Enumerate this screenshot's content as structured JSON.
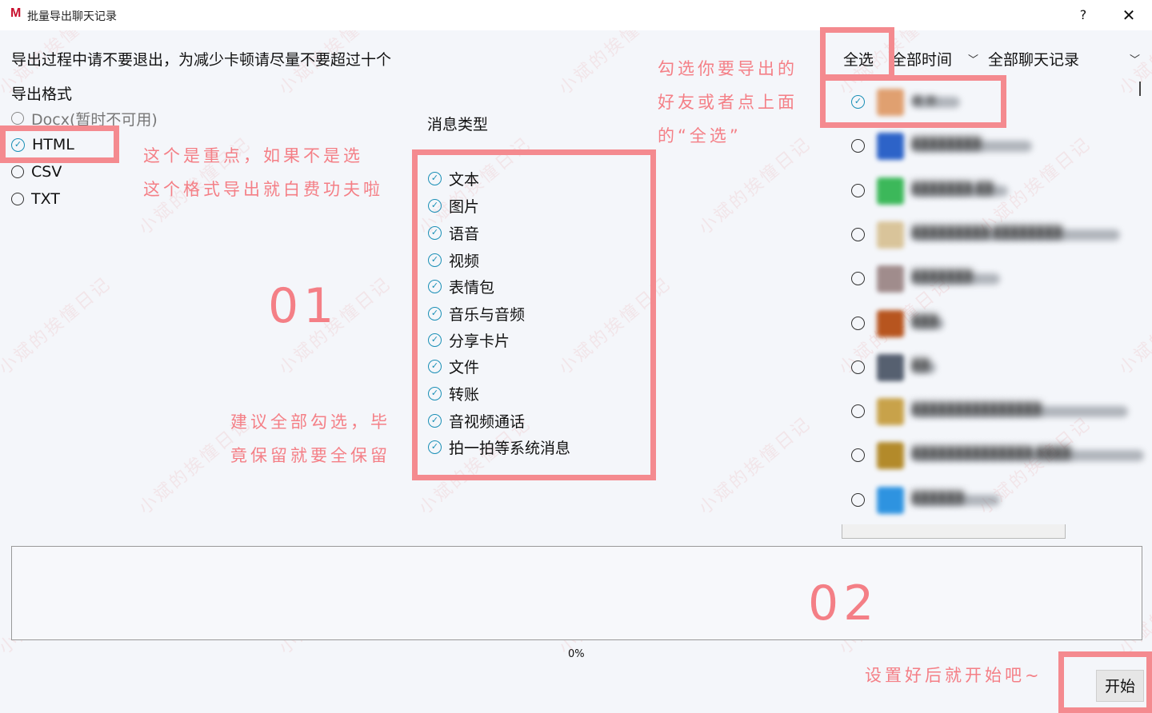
{
  "window": {
    "logo": "M",
    "title": "批量导出聊天记录",
    "help_label": "?",
    "close_label": "✕"
  },
  "notice": "导出过程中请不要退出，为减少卡顿请尽量不要超过十个",
  "export_format": {
    "title": "导出格式",
    "options": [
      {
        "label": "Docx(暂时不可用)",
        "selected": false,
        "disabled": true
      },
      {
        "label": "HTML",
        "selected": true,
        "disabled": false
      },
      {
        "label": "CSV",
        "selected": false,
        "disabled": false
      },
      {
        "label": "TXT",
        "selected": false,
        "disabled": false
      }
    ]
  },
  "message_types": {
    "title": "消息类型",
    "items": [
      "文本",
      "图片",
      "语音",
      "视频",
      "表情包",
      "音乐与音频",
      "分享卡片",
      "文件",
      "转账",
      "音视频通话",
      "拍一拍等系统消息"
    ],
    "all_checked": true
  },
  "top_controls": {
    "select_all": "全选",
    "time_range": "全部时间",
    "record_scope": "全部聊天记录"
  },
  "friends": [
    {
      "checked": true,
      "name": "■ ●",
      "avatar_color": "#e0a070"
    },
    {
      "checked": false,
      "name": "████████",
      "avatar_color": "#2d63c8"
    },
    {
      "checked": false,
      "name": "███████ ██",
      "avatar_color": "#3cb85a"
    },
    {
      "checked": false,
      "name": "█████████ ████████",
      "avatar_color": "#d9c49a"
    },
    {
      "checked": false,
      "name": "███████",
      "avatar_color": "#a08c8c"
    },
    {
      "checked": false,
      "name": "███",
      "avatar_color": "#b7551f"
    },
    {
      "checked": false,
      "name": "██",
      "avatar_color": "#566070"
    },
    {
      "checked": false,
      "name": "███████████████",
      "avatar_color": "#c8a24a"
    },
    {
      "checked": false,
      "name": "██████████████ ████",
      "avatar_color": "#b38a2a"
    },
    {
      "checked": false,
      "name": "██████",
      "avatar_color": "#2e93e0"
    }
  ],
  "progress": {
    "text": "0%",
    "value": 0
  },
  "start_button": "开始",
  "annotations": {
    "html_note": "这个是重点，如果不是选\n这个格式导出就白费功夫啦",
    "num1": "01",
    "select_note": "建议全部勾选，毕\n竟保留就要全保留",
    "friend_note": "勾选你要导出的\n好友或者点上面\n的“全选”",
    "num2": "02",
    "start_note": "设置好后就开始吧~"
  },
  "watermark_text": "小斌的挨憧日记",
  "colors": {
    "highlight": "#f48a8f",
    "check_blue": "#1a8fb6",
    "background": "#f4f6fa"
  }
}
